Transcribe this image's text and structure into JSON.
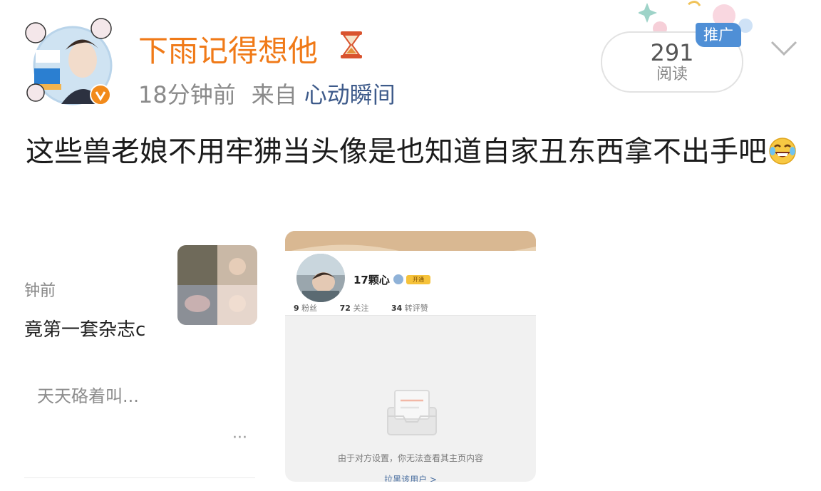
{
  "header": {
    "username": "下雨记得想他",
    "time": "18分钟前",
    "source_prefix": "来自",
    "source": "心动瞬间",
    "read_count": "291",
    "read_label": "阅读",
    "promo_label": "推广"
  },
  "post": {
    "text": "这些兽老娘不用牢狒当头像是也知道自家丑东西拿不出手吧"
  },
  "left_screenshot": {
    "time_fragment": "钟前",
    "text_fragment": "竟第一套杂志c",
    "comment": "天天硌着叫...",
    "more": "···"
  },
  "right_screenshot": {
    "profile_name": "17颗心",
    "vip_label": "开通",
    "stats": [
      {
        "value": "9",
        "label": "粉丝"
      },
      {
        "value": "72",
        "label": "关注"
      },
      {
        "value": "34",
        "label": "转评赞"
      }
    ],
    "empty_message": "由于对方设置，你无法查看其主页内容",
    "follow_text": "拉黑该用户 >"
  },
  "icons": [
    "avatar-image",
    "verified-icon",
    "hourglass-icon",
    "chevron-down-icon",
    "laughing-emoji-icon",
    "empty-box-icon"
  ],
  "colors": {
    "username": "#f07a18",
    "source": "#3d5a8a",
    "promo": "#4f8fd6"
  }
}
